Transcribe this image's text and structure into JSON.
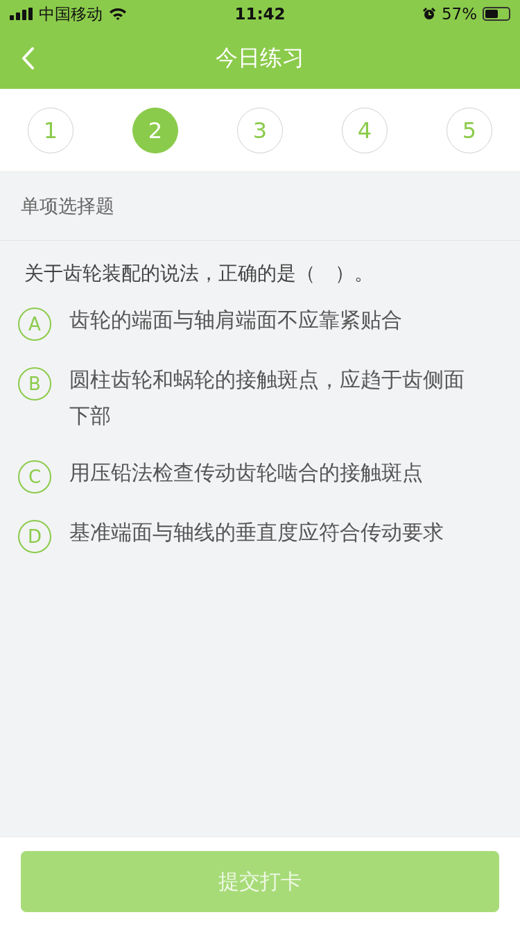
{
  "status_bar": {
    "carrier": "中国移动",
    "time": "11:42",
    "battery": "57%"
  },
  "nav": {
    "title": "今日练习"
  },
  "steps": [
    {
      "label": "1",
      "selected": false
    },
    {
      "label": "2",
      "selected": true
    },
    {
      "label": "3",
      "selected": false
    },
    {
      "label": "4",
      "selected": false
    },
    {
      "label": "5",
      "selected": false
    }
  ],
  "section": {
    "title": "单项选择题"
  },
  "question": {
    "text": "关于齿轮装配的说法，正确的是（　）。"
  },
  "options": [
    {
      "letter": "A",
      "text": "齿轮的端面与轴肩端面不应靠紧贴合",
      "selected": false
    },
    {
      "letter": "B",
      "text": "圆柱齿轮和蜗轮的接触斑点，应趋于齿侧面下部",
      "selected": false
    },
    {
      "letter": "C",
      "text": "用压铅法检查传动齿轮啮合的接触斑点",
      "selected": false
    },
    {
      "letter": "D",
      "text": "基准端面与轴线的垂直度应符合传动要求",
      "selected": false
    }
  ],
  "submit": {
    "label": "提交打卡",
    "disabled": true
  }
}
